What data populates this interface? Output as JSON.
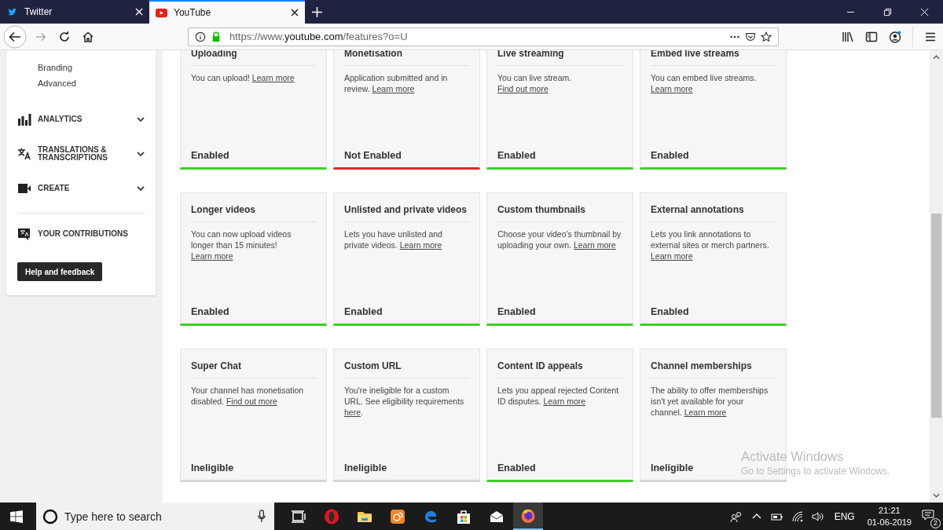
{
  "browser": {
    "tabs": [
      {
        "label": "Twitter",
        "selected": false
      },
      {
        "label": "YouTube",
        "selected": true
      }
    ],
    "url": {
      "scheme": "https://www.",
      "host": "youtube.com",
      "path": "/features?o=U"
    }
  },
  "sidebar": {
    "sub_items": [
      "Branding",
      "Advanced"
    ],
    "sections": [
      {
        "label": "ANALYTICS",
        "expandable": true
      },
      {
        "label": "TRANSLATIONS & TRANSCRIPTIONS",
        "expandable": true
      },
      {
        "label": "CREATE",
        "expandable": true
      },
      {
        "label": "YOUR CONTRIBUTIONS",
        "expandable": false
      }
    ],
    "help_button": "Help and feedback"
  },
  "features": [
    {
      "title": "Uploading",
      "text": "You can upload! ",
      "link": "Learn more",
      "status": "Enabled",
      "kind": "enabled"
    },
    {
      "title": "Monetisation",
      "text": "Application submitted and in review. ",
      "link": "Learn more",
      "status": "Not Enabled",
      "kind": "not_enabled"
    },
    {
      "title": "Live streaming",
      "text": "You can live stream. ",
      "link": "Find out more",
      "status": "Enabled",
      "kind": "enabled"
    },
    {
      "title": "Embed live streams",
      "text": "You can embed live streams. ",
      "link": "Learn more",
      "status": "Enabled",
      "kind": "enabled"
    },
    {
      "title": "Longer videos",
      "text": "You can now upload videos longer than 15 minutes! ",
      "link": "Learn more",
      "status": "Enabled",
      "kind": "enabled"
    },
    {
      "title": "Unlisted and private videos",
      "text": "Lets you have unlisted and private videos. ",
      "link": "Learn more",
      "status": "Enabled",
      "kind": "enabled"
    },
    {
      "title": "Custom thumbnails",
      "text": "Choose your video's thumbnail by uploading your own. ",
      "link": "Learn more",
      "status": "Enabled",
      "kind": "enabled"
    },
    {
      "title": "External annotations",
      "text": "Lets you link annotations to external sites or merch partners. ",
      "link": "Learn more",
      "status": "Enabled",
      "kind": "enabled"
    },
    {
      "title": "Super Chat",
      "text": "Your channel has monetisation disabled. ",
      "link": "Find out more",
      "status": "Ineligible",
      "kind": "ineligible"
    },
    {
      "title": "Custom URL",
      "text": "You're ineligible for a custom URL. See eligibility requirements ",
      "link": "here",
      "tail": ".",
      "status": "Ineligible",
      "kind": "ineligible"
    },
    {
      "title": "Content ID appeals",
      "text": "Lets you appeal rejected Content ID disputes. ",
      "link": "Learn more",
      "status": "Enabled",
      "kind": "enabled"
    },
    {
      "title": "Channel memberships",
      "text": "The ability to offer memberships isn't yet available for your channel. ",
      "link": "Learn more",
      "status": "Ineligible",
      "kind": "ineligible"
    }
  ],
  "activation_notice": {
    "title": "Activate Windows",
    "subtitle": "Go to Settings to activate Windows."
  },
  "taskbar": {
    "search_placeholder": "Type here to search",
    "language": "ENG",
    "time": "21:21",
    "date": "01-06-2019",
    "notification_count": "2"
  }
}
